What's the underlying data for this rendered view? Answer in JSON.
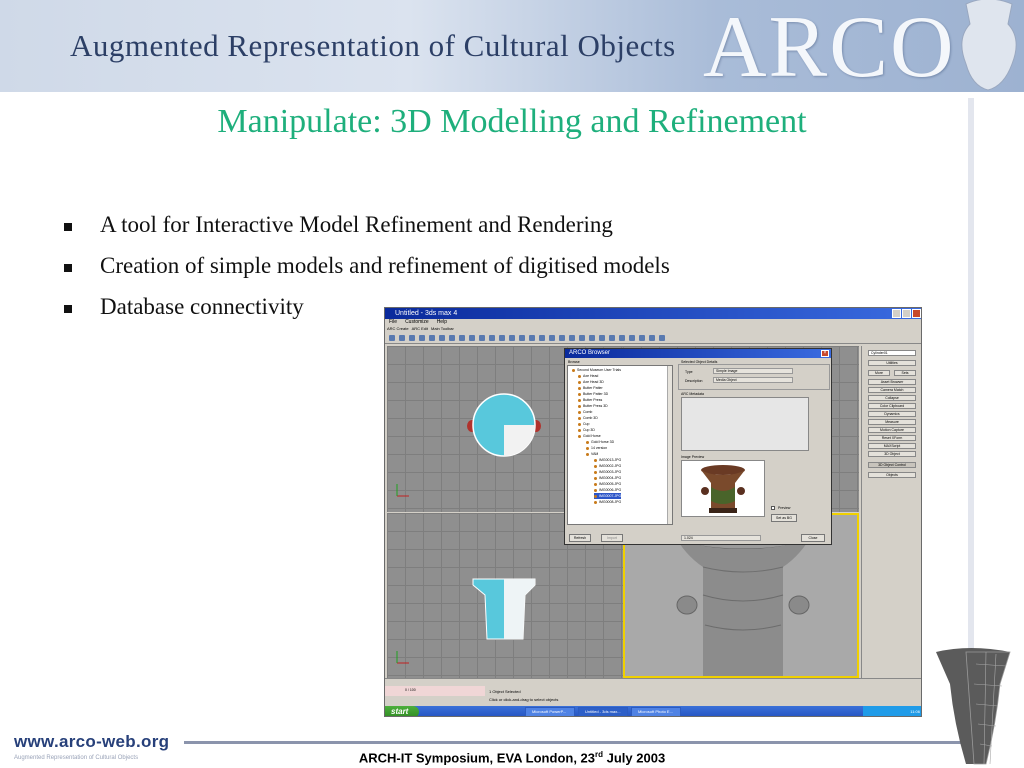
{
  "header": {
    "banner_title": "Augmented Representation of Cultural Objects",
    "logo_text": "ARCO"
  },
  "slide": {
    "title": "Manipulate: 3D Modelling and Refinement",
    "bullets": [
      "A tool for Interactive Model Refinement and Rendering",
      "Creation of simple models and refinement of digitised models",
      "Database connectivity"
    ]
  },
  "screenshot": {
    "window_title": "Untitled - 3ds max 4",
    "menu": [
      "File",
      "Customize",
      "Help"
    ],
    "tabs": [
      "ARC Create",
      "ARC Edit",
      "Main Toolbar"
    ],
    "dialog": {
      "title": "ARCO Browser",
      "browse_label": "Browse",
      "tree_items": [
        "Second Museum User Trials",
        "Axe Head",
        "Axe Head 3D",
        "Butter Patter",
        "Butter Patter 3D",
        "Butter Press",
        "Butter Press 3D",
        "Comb",
        "Comb 3D",
        "Cup",
        "Cup 3D",
        "Gold Horse",
        "Gold Horse 3D",
        "14 version",
        "VAM",
        "IMG0013.JPG",
        "IMG0002.JPG",
        "IMG0003.JPG",
        "IMG0004.JPG",
        "IMG0005.JPG",
        "IMG0006.JPG",
        "IMG0007.JPG",
        "IMG0008.JPG"
      ],
      "selected_item": "IMG0007.JPG",
      "details_label": "Selected Object Details",
      "type_label": "Type",
      "type_value": "Simple Image",
      "description_label": "Description",
      "description_value": "Media Object",
      "metadata_label": "ARC Metadata",
      "preview_label": "Image Preview",
      "preview_checkbox": "Preview",
      "set_bg_button": "Set as BG",
      "refresh_button": "Refresh",
      "import_button": "Import",
      "status_value": "1.024",
      "close_button": "Close"
    },
    "command_panel": {
      "field": "Cylinder01",
      "buttons": [
        "Utilities",
        "More",
        "Sets",
        "Asset Browser",
        "Camera Match",
        "Collapse",
        "Color Clipboard",
        "Dynamics",
        "Measure",
        "Motion Capture",
        "Reset XForm",
        "MAXScript",
        "3D Object",
        "3D Object Control",
        "Objects"
      ]
    },
    "timeline": "0 / 100",
    "status_line_1": "1 Object Selected",
    "status_line_2": "Click or click-and-drag to select objects",
    "taskbar": {
      "start": "start",
      "tasks": [
        "Microsoft PowerP...",
        "Untitled - 3ds max...",
        "Microsoft Photo E..."
      ],
      "clock": "11:06"
    }
  },
  "footer": {
    "url": "www.arco-web.org",
    "sub": "Augmented Representation of Cultural Objects",
    "event": "ARCH-IT Symposium, EVA London, 23",
    "event_sup": "rd",
    "event_tail": " July 2003"
  },
  "colors": {
    "title": "#1eaf7c",
    "banner_text": "#2c3f66",
    "footer_url": "#27407a",
    "viewport_grid": "#8f8f8f",
    "dialog_titlebar": "#0a2a9c"
  }
}
